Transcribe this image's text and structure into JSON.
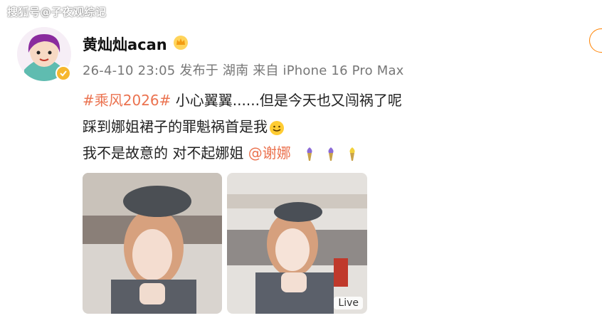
{
  "watermark": "搜狐号@子夜观综记",
  "post": {
    "username": "黄灿灿acan",
    "meta": "26-4-10 23:05  发布于 湖南  来自 iPhone 16 Pro Max",
    "hashtag": "#乘风2026#",
    "line1_text": " 小心翼翼......但是今天也又闯祸了呢",
    "line2_text": "踩到娜姐裙子的罪魁祸首是我",
    "line3_text": "我不是故意的 对不起娜姐 ",
    "mention": "@谢娜",
    "icons": [
      "crown-icon",
      "verified-icon",
      "smile-emoji",
      "torch-emoji"
    ],
    "photos": [
      {
        "alt": "selfie-1"
      },
      {
        "alt": "selfie-2",
        "badge": "Live"
      }
    ]
  },
  "colors": {
    "link": "#eb7350",
    "meta": "#777777",
    "accent": "#ff8200",
    "verified": "#f6b72e"
  }
}
